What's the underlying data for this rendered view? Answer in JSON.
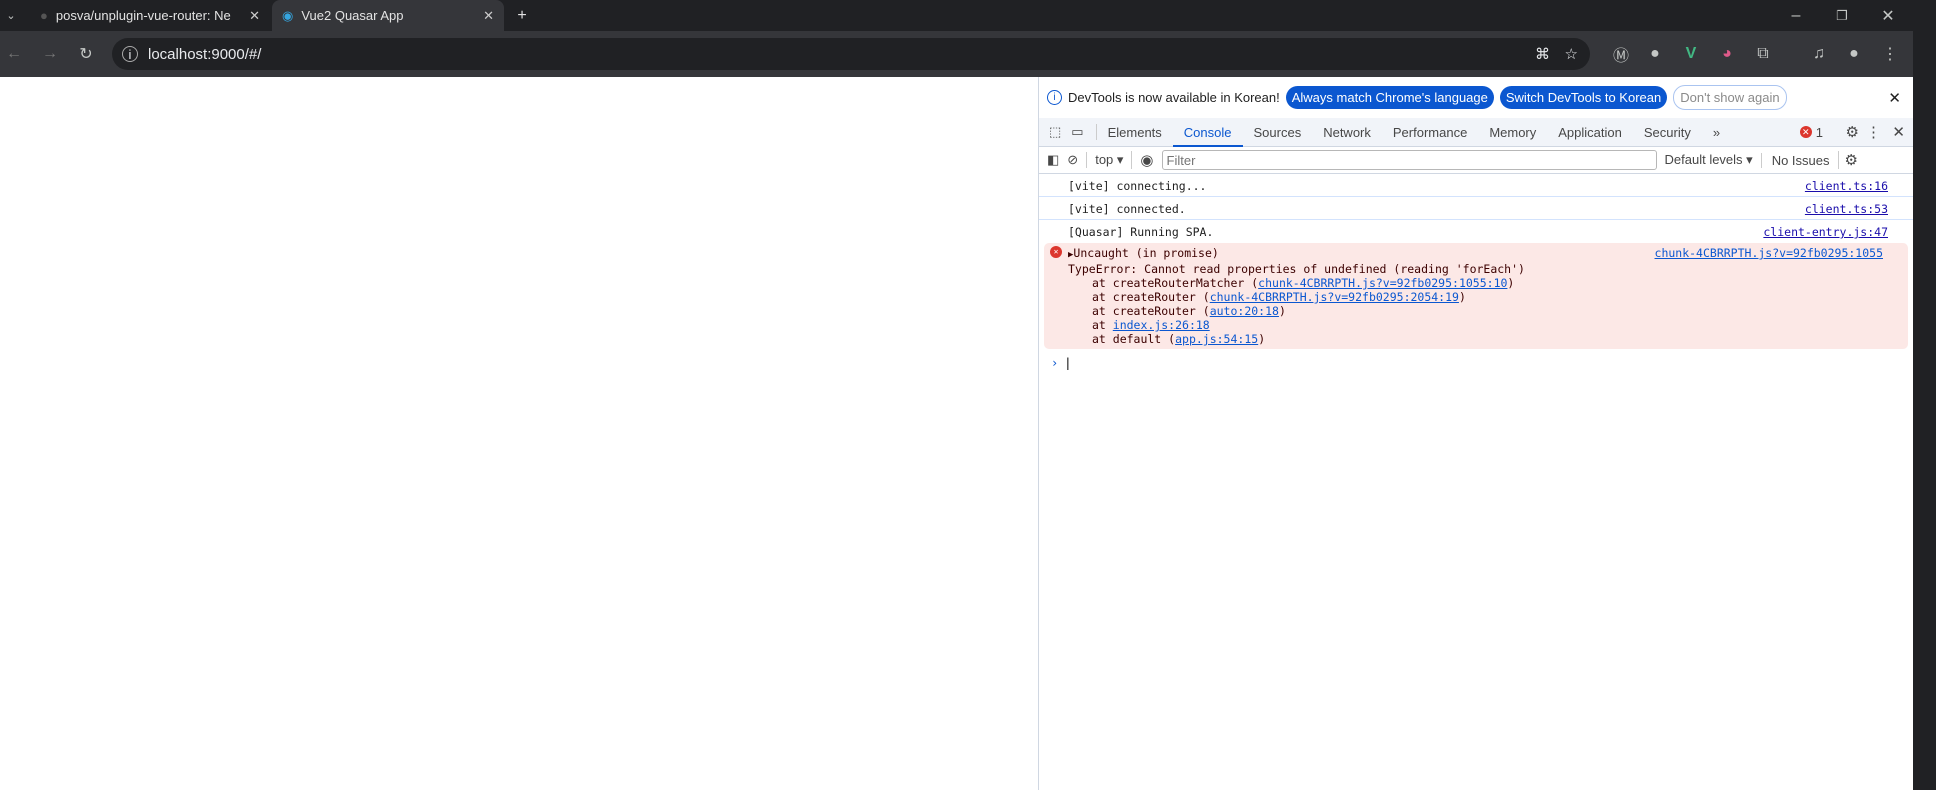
{
  "browser": {
    "tabs": [
      {
        "title": "posva/unplugin-vue-router: Ne",
        "active": false
      },
      {
        "title": "Vue2 Quasar App",
        "active": true
      }
    ],
    "url": "localhost:9000/#/"
  },
  "devtools": {
    "info": {
      "message": "DevTools is now available in Korean!",
      "btn_match": "Always match Chrome's language",
      "btn_switch": "Switch DevTools to Korean",
      "btn_dont": "Don't show again"
    },
    "tabs": [
      "Elements",
      "Console",
      "Sources",
      "Network",
      "Performance",
      "Memory",
      "Application",
      "Security"
    ],
    "active_tab": "Console",
    "error_count": "1",
    "context": "top",
    "filter_placeholder": "Filter",
    "levels": "Default levels",
    "issues": "No Issues",
    "messages": [
      {
        "text": "[vite] connecting...",
        "source": "client.ts:16"
      },
      {
        "text": "[vite] connected.",
        "source": "client.ts:53"
      },
      {
        "text": "[Quasar] Running SPA.",
        "source": "client-entry.js:47"
      }
    ],
    "error": {
      "summary": "Uncaught (in promise)",
      "source": "chunk-4CBRRPTH.js?v=92fb0295:1055",
      "message": "TypeError: Cannot read properties of undefined (reading 'forEach')",
      "stack": [
        {
          "prefix": "at createRouterMatcher (",
          "link": "chunk-4CBRRPTH.js?v=92fb0295:1055:10",
          "suffix": ")"
        },
        {
          "prefix": "at createRouter (",
          "link": "chunk-4CBRRPTH.js?v=92fb0295:2054:19",
          "suffix": ")"
        },
        {
          "prefix": "at createRouter (",
          "link": "auto:20:18",
          "suffix": ")"
        },
        {
          "prefix": "at ",
          "link": "index.js:26:18",
          "suffix": ""
        },
        {
          "prefix": "at default (",
          "link": "app.js:54:15",
          "suffix": ")"
        }
      ]
    }
  }
}
